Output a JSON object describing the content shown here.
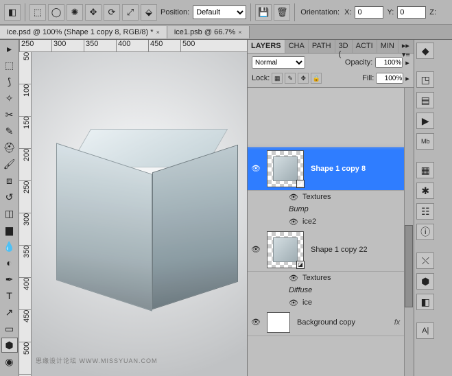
{
  "toolbar": {
    "position_label": "Position:",
    "position_value": "Default",
    "orientation_label": "Orientation:",
    "x_label": "X:",
    "x_value": "0",
    "y_label": "Y:",
    "y_value": "0",
    "z_label": "Z:"
  },
  "doc_tabs": [
    {
      "title": "ice.psd @ 100% (Shape 1 copy 8, RGB/8) *",
      "active": true
    },
    {
      "title": "ice1.psb @ 66.7%",
      "active": false
    }
  ],
  "rulers_h": [
    "250",
    "300",
    "350",
    "400",
    "450",
    "500"
  ],
  "rulers_v": [
    "50",
    "100",
    "150",
    "200",
    "250",
    "300",
    "350",
    "400",
    "450",
    "500"
  ],
  "watermark": "思缘设计论坛  WWW.MISSYUAN.COM",
  "layers_panel": {
    "tabs": [
      "LAYERS",
      "CHA",
      "PATH",
      "3D (",
      "ACTI",
      "MIN"
    ],
    "blend_mode": "Normal",
    "opacity_label": "Opacity:",
    "opacity_value": "100%",
    "lock_label": "Lock:",
    "fill_label": "Fill:",
    "fill_value": "100%",
    "layers": [
      {
        "name": "Shape 1 copy 8",
        "selected": true,
        "visible": true,
        "subs": [
          {
            "type": "fx",
            "label": "Textures",
            "eye": true
          },
          {
            "type": "italic",
            "label": "Bump"
          },
          {
            "type": "sub",
            "label": "ice2",
            "eye": true
          }
        ]
      },
      {
        "name": "Shape 1 copy 22",
        "selected": false,
        "visible": true,
        "subs": [
          {
            "type": "fx",
            "label": "Textures",
            "eye": true
          },
          {
            "type": "italic",
            "label": "Diffuse"
          },
          {
            "type": "sub",
            "label": "ice",
            "eye": true
          }
        ]
      },
      {
        "name": "Background copy",
        "selected": false,
        "visible": true,
        "fx": "fx",
        "solid": true
      }
    ]
  },
  "icons": {
    "arrow_down": "▾"
  }
}
